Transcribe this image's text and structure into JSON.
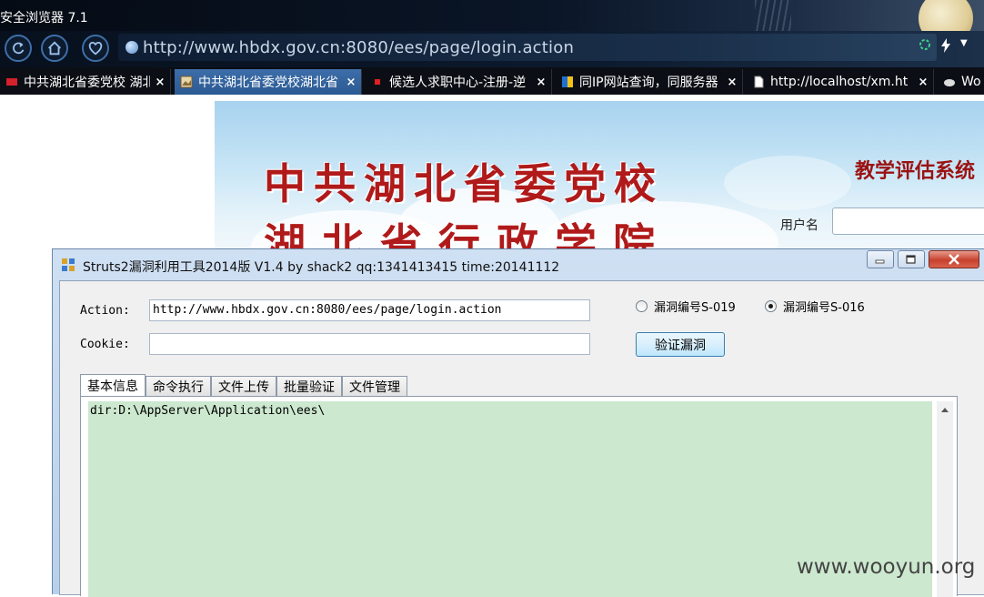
{
  "browser": {
    "title": "安全浏览器 7.1",
    "url": "http://www.hbdx.gov.cn:8080/ees/page/login.action",
    "tabs": [
      {
        "label": "中共湖北省委党校 湖北省",
        "favicon": "flag-icon",
        "active": false
      },
      {
        "label": "中共湖北省委党校湖北省",
        "favicon": "page-image-icon",
        "active": true
      },
      {
        "label": "候选人求职中心-注册-逆",
        "favicon": "red-square-icon",
        "active": false
      },
      {
        "label": "同IP网站查询，同服务器",
        "favicon": "site-icon",
        "active": false
      },
      {
        "label": "http://localhost/xm.ht",
        "favicon": "document-icon",
        "active": false
      },
      {
        "label": "Wo",
        "favicon": "cloud-icon",
        "active": false
      }
    ],
    "close_glyph": "×"
  },
  "page": {
    "school_name_line1": "中共湖北省委党校",
    "school_name_line2": "湖北省行政学院",
    "system_title": "教学评估系统",
    "username_label": "用户名"
  },
  "tool": {
    "window_title": "Struts2漏洞利用工具2014版 V1.4 by shack2 qq:1341413415 time:20141112",
    "action_label": "Action:",
    "action_value": "http://www.hbdx.gov.cn:8080/ees/page/login.action",
    "cookie_label": "Cookie:",
    "cookie_value": "",
    "radio_options": [
      {
        "label": "漏洞编号S-019",
        "checked": false
      },
      {
        "label": "漏洞编号S-016",
        "checked": true
      }
    ],
    "verify_button": "验证漏洞",
    "tabs": [
      "基本信息",
      "命令执行",
      "文件上传",
      "批量验证",
      "文件管理"
    ],
    "active_tab": "基本信息",
    "output_text": "dir:D:\\AppServer\\Application\\ees\\"
  },
  "watermark": "www.wooyun.org",
  "colors": {
    "browser_dark": "#0b0f15",
    "active_tab": "#3d6ea9",
    "school_red": "#b01a1a",
    "output_bg": "#cce8cf",
    "window_frame": "#b9d0ea"
  }
}
